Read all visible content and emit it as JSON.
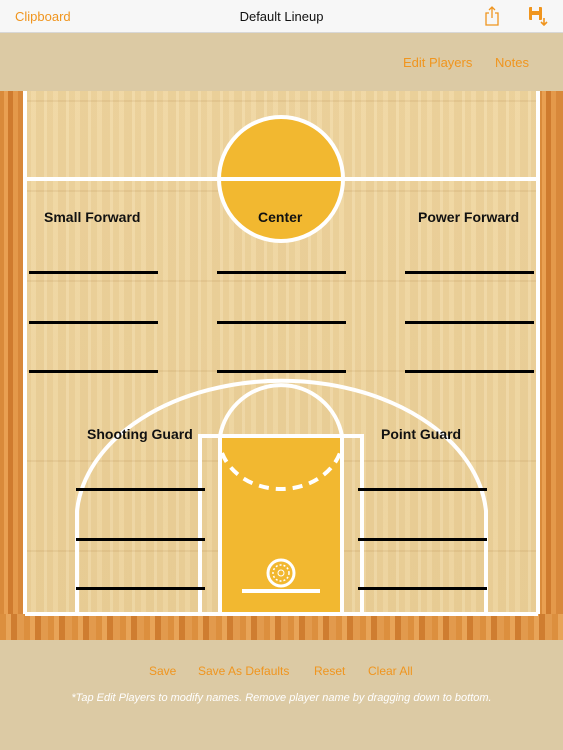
{
  "navbar": {
    "back_label": "Clipboard",
    "title": "Default Lineup",
    "share_icon": "share-icon",
    "save_icon": "save-download-icon"
  },
  "toolbar": {
    "edit_players_label": "Edit Players",
    "notes_label": "Notes"
  },
  "court": {
    "positions": {
      "small_forward": "Small Forward",
      "center": "Center",
      "power_forward": "Power Forward",
      "shooting_guard": "Shooting Guard",
      "point_guard": "Point Guard"
    },
    "colors": {
      "accent": "#f0951e",
      "wood": "#ecd29b",
      "paint": "#f2b830",
      "lines": "#ffffff"
    }
  },
  "bottom": {
    "save_label": "Save",
    "save_defaults_label": "Save As Defaults",
    "reset_label": "Reset",
    "clear_all_label": "Clear All",
    "hint": "*Tap Edit Players to modify names.  Remove player name by dragging down to bottom."
  }
}
